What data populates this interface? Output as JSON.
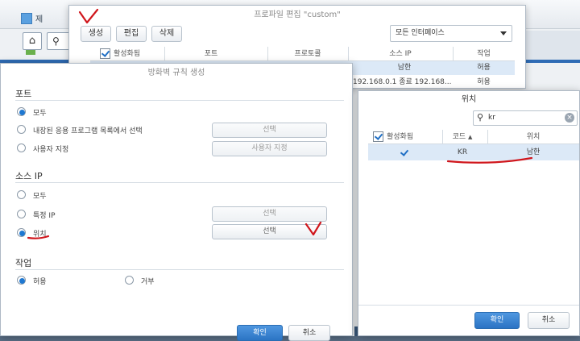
{
  "background": {
    "app_title": "제",
    "home_icon": "home-icon",
    "search_icon": "search-icon"
  },
  "profile_editor": {
    "title": "프로파일 편집 \"custom\"",
    "buttons": {
      "create": "생성",
      "edit": "편집",
      "delete": "삭제"
    },
    "interface_select": "모든 인터페이스",
    "columns": [
      "활성화됨",
      "포트",
      "프로토콜",
      "소스 IP",
      "작업"
    ],
    "rows": [
      {
        "enabled": true,
        "port": "",
        "protocol": "",
        "source_ip": "남한",
        "action": "허용"
      },
      {
        "enabled": true,
        "port": "",
        "protocol": "",
        "source_ip": "192.168.0.1 종료 192.168...",
        "action": "허용"
      }
    ]
  },
  "rule_dialog": {
    "title": "방화벽 규칙 생성",
    "port_section": {
      "heading": "포트",
      "options": [
        {
          "label": "모두",
          "selected": true
        },
        {
          "label": "내장된 응용 프로그램 목록에서 선택",
          "selected": false,
          "button": "선택"
        },
        {
          "label": "사용자 지정",
          "selected": false,
          "button": "사용자 지정"
        }
      ]
    },
    "source_section": {
      "heading": "소스 IP",
      "options": [
        {
          "label": "모두",
          "selected": false
        },
        {
          "label": "특정 IP",
          "selected": false,
          "button": "선택"
        },
        {
          "label": "위치",
          "selected": true,
          "button": "선택"
        }
      ]
    },
    "action_section": {
      "heading": "작업",
      "allow": "허용",
      "deny": "거부",
      "selected": "허용"
    },
    "footer": {
      "confirm": "확인",
      "cancel": "취소"
    }
  },
  "location_window": {
    "title": "위치",
    "search_value": "kr",
    "columns": {
      "enabled": "활성화됨",
      "code": "코드",
      "location": "위치"
    },
    "rows": [
      {
        "enabled": true,
        "code": "KR",
        "location": "남한"
      }
    ],
    "footer": {
      "confirm": "확인",
      "cancel": "취소"
    }
  },
  "colors": {
    "accent": "#1f78d1",
    "annotation": "#d0161c"
  }
}
